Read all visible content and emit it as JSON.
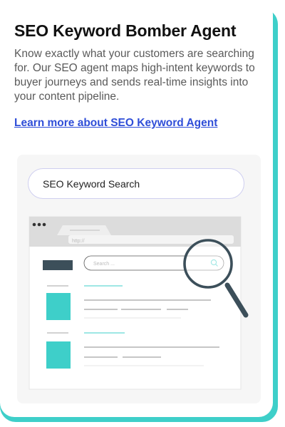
{
  "card": {
    "title": "SEO Keyword Bomber Agent",
    "description": "Know exactly what your customers are searching for. Our SEO agent maps high-intent keywords to buyer journeys and sends real-time insights into your content pipeline.",
    "link_label": "Learn more about SEO Keyword Agent"
  },
  "illustration": {
    "search_label": "SEO Keyword Search",
    "url_text": "http://",
    "browser_search_placeholder": "Search ..."
  },
  "colors": {
    "accent": "#3ecfc9",
    "link": "#2f4ed8",
    "title": "#111111",
    "body_text": "#5a5a5a",
    "dark_block": "#3c4f5a",
    "teal_block": "#3ecfc9"
  }
}
